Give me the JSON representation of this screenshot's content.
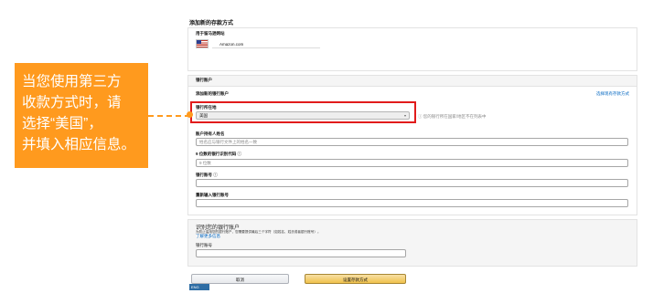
{
  "page": {
    "title": "添加新的存款方式"
  },
  "marketplace": {
    "label": "用于留马逊网站",
    "domain": "Amazon.com"
  },
  "account_section": {
    "header": "银行账户",
    "add_new_label": "添加新的银行账户",
    "choose_link": "选择现有存款方式",
    "location_label": "银行所在地",
    "location_value": "美国",
    "location_hint": "您的银行所在国家/地区不在列表中",
    "holder_label": "账户持有人姓名",
    "holder_placeholder": "姓名应与银行文件上的姓名一致",
    "routing_label": "9 位数的银行识别代码",
    "routing_placeholder": "9 位数",
    "account_label": "银行账号",
    "reenter_label": "重新输入银行账号"
  },
  "identify": {
    "title": "识别您的银行账户",
    "desc": "为防止滥用您的银行账户，您需要提供最后三个字符（如姓名、姓氏或者银行账号）。",
    "learn_more": "了解更多信息",
    "field_label": "银行账号"
  },
  "buttons": {
    "cancel": "取消",
    "set": "设置存款方式"
  },
  "lang_badge": "ENG",
  "callout": {
    "lines": [
      "当您使用第三方",
      "收款方式时，请",
      "选择“美国”，",
      "并填入相应信息。"
    ]
  }
}
